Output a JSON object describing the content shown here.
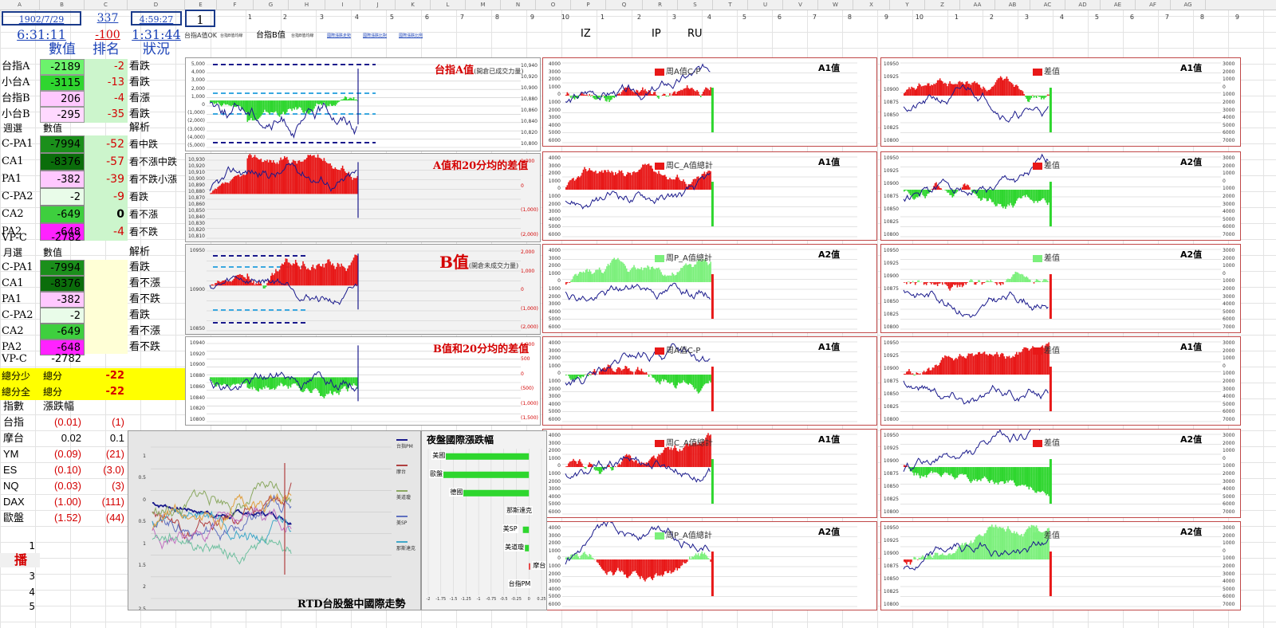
{
  "columns": [
    "A",
    "B",
    "C",
    "D",
    "E",
    "F",
    "G",
    "H",
    "I",
    "J",
    "K",
    "L",
    "M",
    "N",
    "O",
    "P",
    "Q",
    "R",
    "S",
    "T",
    "U",
    "V",
    "W",
    "X",
    "Y",
    "Z",
    "AA",
    "AB",
    "AC",
    "AD",
    "AE",
    "AF",
    "AG"
  ],
  "row1_nums": [
    "1",
    "2",
    "3",
    "4",
    "5",
    "6",
    "7",
    "8",
    "9",
    "10",
    "1",
    "2",
    "3",
    "4",
    "5",
    "6",
    "7",
    "8",
    "9",
    "10",
    "1",
    "2",
    "3",
    "4",
    "5",
    "6",
    "7",
    "8",
    "9"
  ],
  "header": {
    "date": "1902/7/29",
    "count": "337",
    "time1": "4:59:27",
    "index_box": "1",
    "time2": "6:31:11",
    "rank_change": "-100",
    "time3": "1:31:44",
    "col_value": "數值",
    "col_rank": "排名",
    "col_status": "狀況",
    "link1": "台指A值OK",
    "link2": "台指B值",
    "tag_iz": "IZ",
    "tag_ip": "IP",
    "tag_ru": "RU",
    "tiny1": "台指B值均線",
    "tiny2": "台指B值均線",
    "tiny3": "國際漲跌走勢",
    "tiny4": "國際漲跌比對",
    "tiny5": "國際漲跌比例"
  },
  "top_rows": [
    {
      "name": "台指A",
      "value": "-2189",
      "rank": "-2",
      "status": "看跌",
      "bg": "#6cf36c"
    },
    {
      "name": "小台A",
      "value": "-3115",
      "rank": "-13",
      "status": "看跌",
      "bg": "#2fd62f"
    },
    {
      "name": "台指B",
      "value": "206",
      "rank": "-4",
      "status": "看漲",
      "bg": "#ffc8ff"
    },
    {
      "name": "小台B",
      "value": "-295",
      "rank": "-35",
      "status": "看跌",
      "bg": "#ffd9ff"
    }
  ],
  "weekly": {
    "title": "週選",
    "value_h": "數值",
    "analysis_h": "解析",
    "rows": [
      {
        "name": "C-PA1",
        "value": "-7994",
        "rank": "-52",
        "status": "看中跌",
        "bg": "#1b8f1b"
      },
      {
        "name": "CA1",
        "value": "-8376",
        "rank": "-57",
        "status": "看不漲中跌",
        "bg": "#0b6d0b"
      },
      {
        "name": "PA1",
        "value": "-382",
        "rank": "-39",
        "status": "看不跌小漲",
        "bg": "#ffc8ff"
      },
      {
        "name": "C-PA2",
        "value": "-2",
        "rank": "-9",
        "status": "看跌",
        "bg": "#e9fce9"
      },
      {
        "name": "CA2",
        "value": "-649",
        "rank": "0",
        "status": "看不漲",
        "bg": "#3ecf3e"
      },
      {
        "name": "PA2",
        "value": "-648",
        "rank": "-4",
        "status": "看不跌",
        "bg": "#ff22ff"
      }
    ],
    "vpc_label": "VP-C",
    "vpc_value": "-2782"
  },
  "monthly": {
    "title": "月選",
    "value_h": "數值",
    "analysis_h": "解析",
    "rows": [
      {
        "name": "C-PA1",
        "value": "-7994",
        "status": "看跌",
        "bg": "#1b8f1b"
      },
      {
        "name": "CA1",
        "value": "-8376",
        "status": "看不漲",
        "bg": "#0b6d0b"
      },
      {
        "name": "PA1",
        "value": "-382",
        "status": "看不跌",
        "bg": "#ffc8ff"
      },
      {
        "name": "C-PA2",
        "value": "-2",
        "status": "看跌",
        "bg": "#e9fce9"
      },
      {
        "name": "CA2",
        "value": "-649",
        "status": "看不漲",
        "bg": "#3ecf3e"
      },
      {
        "name": "PA2",
        "value": "-648",
        "status": "看不跌",
        "bg": "#ff22ff"
      }
    ],
    "vpc_label": "VP-C",
    "vpc_value": "-2782"
  },
  "totals": [
    {
      "label": "總分少",
      "label2": "總分",
      "value": "-22"
    },
    {
      "label": "總分全",
      "label2": "總分",
      "value": "-22"
    }
  ],
  "index_section": {
    "h1": "指數",
    "h2": "漲跌幅",
    "rows": [
      {
        "name": "台指",
        "pct": "(0.01)",
        "chg": "(1)",
        "red": true
      },
      {
        "name": "摩台",
        "pct": "0.02",
        "chg": "0.1",
        "red": false
      },
      {
        "name": "YM",
        "pct": "(0.09)",
        "chg": "(21)",
        "red": true
      },
      {
        "name": "ES",
        "pct": "(0.10)",
        "chg": "(3.0)",
        "red": true
      },
      {
        "name": "NQ",
        "pct": "(0.03)",
        "chg": "(3)",
        "red": true
      },
      {
        "name": "DAX",
        "pct": "(1.00)",
        "chg": "(111)",
        "red": true
      },
      {
        "name": "歐盤",
        "pct": "(1.52)",
        "chg": "(44)",
        "red": true
      }
    ]
  },
  "broadcast": {
    "n1": "1",
    "label": "播",
    "n3": "3",
    "n4": "4",
    "n5": "5"
  },
  "panels": {
    "p1_title": "台指A值",
    "p1_sub": "(開倉已成交力量)",
    "p1_left": [
      "5,000",
      "4,000",
      "3,000",
      "2,000",
      "1,000",
      "0",
      "(1,000)",
      "(2,000)",
      "(3,000)",
      "(4,000)",
      "(5,000)"
    ],
    "p1_right": [
      "10,940",
      "10,920",
      "10,900",
      "10,880",
      "10,860",
      "10,840",
      "10,820",
      "10,800"
    ],
    "p2_title": "A值和20分均的差值",
    "p2_left": [
      "10,930",
      "10,920",
      "10,910",
      "10,900",
      "10,890",
      "10,880",
      "10,870",
      "10,860",
      "10,850",
      "10,840",
      "10,830",
      "10,820",
      "10,810"
    ],
    "p2_right": [
      "1,000",
      "0",
      "(1,000)",
      "(2,000)"
    ],
    "p3_title": "B值",
    "p3_sub": "(開倉未成交力量)",
    "p3_left": [
      "10950",
      "10900",
      "10850"
    ],
    "p3_right": [
      "2,000",
      "1,000",
      "0",
      "(1,000)",
      "(2,000)"
    ],
    "p4_title": "B值和20分均的差值",
    "p4_left": [
      "10940",
      "10920",
      "10900",
      "10880",
      "10860",
      "10840",
      "10820",
      "10800"
    ],
    "p4_right": [
      "1,000",
      "500",
      "0",
      "(500)",
      "(1,000)",
      "(1,500)"
    ],
    "grid_tags": [
      "A1值",
      "A1值",
      "A1值",
      "A2值",
      "A2值",
      "A2值",
      "A1值",
      "A1值",
      "A1值",
      "A2值",
      "A2值",
      "A2值"
    ],
    "legend_mid": [
      "周A值C-P",
      "周C_A值總計",
      "周P_A值總計",
      "周A值C-P",
      "周C_A值總計",
      "周P_A值總計"
    ],
    "legend_right": "差值",
    "mid_left": [
      "4000",
      "3000",
      "2000",
      "1000",
      "0",
      "1000",
      "2000",
      "3000",
      "4000",
      "5000",
      "6000"
    ],
    "right_left": [
      "10950",
      "10925",
      "10900",
      "10875",
      "10850",
      "10825",
      "10800"
    ],
    "right_axis": [
      "3000",
      "2000",
      "1000",
      "0",
      "1000",
      "2000",
      "3000",
      "4000",
      "5000",
      "6000",
      "7000"
    ]
  },
  "line_chart": {
    "title": "RTD台股盤中國際走勢",
    "yticks": [
      "1",
      "0.5",
      "0",
      "0.5",
      "1",
      "1.5",
      "2",
      "2.5"
    ],
    "legend": [
      "台指PM",
      "摩台",
      "美道瓊",
      "美SP",
      "那斯達克"
    ]
  },
  "chart_data": {
    "type": "bar",
    "title": "夜盤國際漲跌幅",
    "categories": [
      "美國",
      "歐盤",
      "德國",
      "那斯達克",
      "美SP",
      "美道瓊",
      "摩台",
      "台指PM"
    ],
    "values": [
      -1.9,
      -1.95,
      -1.55,
      -0.05,
      -0.12,
      -0.08,
      0.02,
      -0.01
    ],
    "xlim": [
      -2,
      0.25
    ],
    "xticks": [
      "-2",
      "-1.75",
      "-1.5",
      "-1.25",
      "-1",
      "-0.75",
      "-0.5",
      "-0.25",
      "0",
      "0.25"
    ]
  }
}
